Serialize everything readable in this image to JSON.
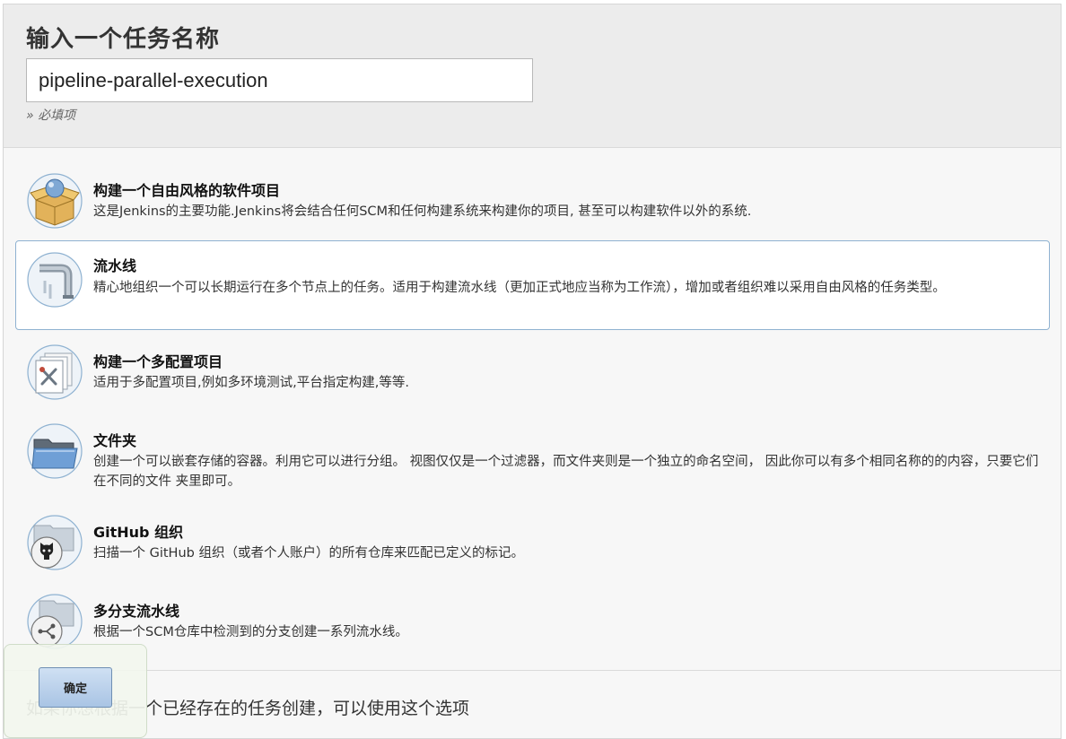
{
  "header": {
    "title": "输入一个任务名称",
    "name_value": "pipeline-parallel-execution",
    "required_note": "» 必填项"
  },
  "items": [
    {
      "icon": "freestyle-box-icon",
      "name": "构建一个自由风格的软件项目",
      "desc": "这是Jenkins的主要功能.Jenkins将会结合任何SCM和任何构建系统来构建你的项目, 甚至可以构建软件以外的系统.",
      "selected": false
    },
    {
      "icon": "pipeline-icon",
      "name": "流水线",
      "desc": "精心地组织一个可以长期运行在多个节点上的任务。适用于构建流水线（更加正式地应当称为工作流），增加或者组织难以采用自由风格的任务类型。",
      "selected": true
    },
    {
      "icon": "multi-config-icon",
      "name": "构建一个多配置项目",
      "desc": "适用于多配置项目,例如多环境测试,平台指定构建,等等.",
      "selected": false
    },
    {
      "icon": "folder-icon",
      "name": "文件夹",
      "desc": "创建一个可以嵌套存储的容器。利用它可以进行分组。 视图仅仅是一个过滤器，而文件夹则是一个独立的命名空间， 因此你可以有多个相同名称的的内容，只要它们在不同的文件 夹里即可。",
      "selected": false
    },
    {
      "icon": "github-org-icon",
      "name": "GitHub 组织",
      "desc": "扫描一个 GitHub 组织（或者个人账户）的所有仓库来匹配已定义的标记。",
      "selected": false
    },
    {
      "icon": "multibranch-pipeline-icon",
      "name": "多分支流水线",
      "desc": "根据一个SCM仓库中检测到的分支创建一系列流水线。",
      "selected": false
    }
  ],
  "copy": {
    "text": "如果你想根据一个已经存在的任务创建，可以使用这个选项"
  },
  "ok_button": {
    "label": "确定"
  },
  "colors": {
    "selected_border": "#8fb2d1",
    "header_bg": "#ececec",
    "panel_bg": "#f7f7f7"
  }
}
